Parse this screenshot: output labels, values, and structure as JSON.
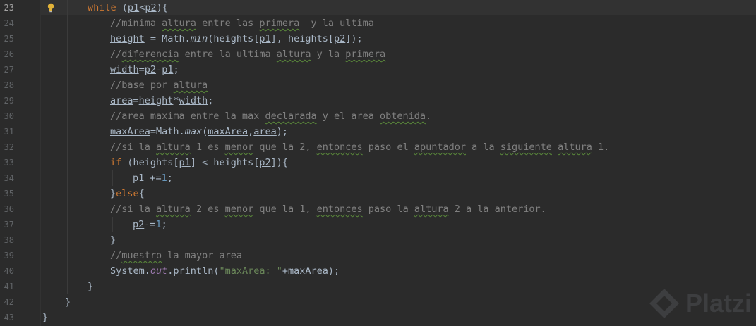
{
  "editor": {
    "line_numbers": [
      "23",
      "24",
      "25",
      "26",
      "27",
      "28",
      "29",
      "30",
      "31",
      "32",
      "33",
      "34",
      "35",
      "36",
      "37",
      "38",
      "39",
      "40",
      "41",
      "42",
      "43"
    ],
    "watermark": "Platzi",
    "lines": [
      {
        "indent": 2,
        "tokens": [
          {
            "t": "while ",
            "c": "kw"
          },
          {
            "t": "("
          },
          {
            "t": "p1",
            "c": "var"
          },
          {
            "t": "<"
          },
          {
            "t": "p2",
            "c": "var"
          },
          {
            "t": "){"
          }
        ]
      },
      {
        "indent": 3,
        "tokens": [
          {
            "t": "//minima ",
            "c": "cm"
          },
          {
            "t": "altura",
            "c": "cm typo"
          },
          {
            "t": " entre las ",
            "c": "cm"
          },
          {
            "t": "primera",
            "c": "cm typo"
          },
          {
            "t": "  y la ultima",
            "c": "cm"
          }
        ]
      },
      {
        "indent": 3,
        "tokens": [
          {
            "t": "height",
            "c": "var"
          },
          {
            "t": " = Math."
          },
          {
            "t": "min",
            "c": "mt"
          },
          {
            "t": "(heights["
          },
          {
            "t": "p1",
            "c": "var"
          },
          {
            "t": "], heights["
          },
          {
            "t": "p2",
            "c": "var"
          },
          {
            "t": "]);"
          }
        ]
      },
      {
        "indent": 3,
        "tokens": [
          {
            "t": "//",
            "c": "cm"
          },
          {
            "t": "diferencia",
            "c": "cm typo"
          },
          {
            "t": " entre la ultima ",
            "c": "cm"
          },
          {
            "t": "altura",
            "c": "cm typo"
          },
          {
            "t": " y la ",
            "c": "cm"
          },
          {
            "t": "primera",
            "c": "cm typo"
          }
        ]
      },
      {
        "indent": 3,
        "tokens": [
          {
            "t": "width",
            "c": "var"
          },
          {
            "t": "="
          },
          {
            "t": "p2",
            "c": "var"
          },
          {
            "t": "-"
          },
          {
            "t": "p1",
            "c": "var"
          },
          {
            "t": ";"
          }
        ]
      },
      {
        "indent": 3,
        "tokens": [
          {
            "t": "//base por ",
            "c": "cm"
          },
          {
            "t": "altura",
            "c": "cm typo"
          }
        ]
      },
      {
        "indent": 3,
        "tokens": [
          {
            "t": "area",
            "c": "var"
          },
          {
            "t": "="
          },
          {
            "t": "height",
            "c": "var"
          },
          {
            "t": "*"
          },
          {
            "t": "width",
            "c": "var"
          },
          {
            "t": ";"
          }
        ]
      },
      {
        "indent": 3,
        "tokens": [
          {
            "t": "//area maxima entre la max ",
            "c": "cm"
          },
          {
            "t": "declarada",
            "c": "cm typo"
          },
          {
            "t": " y el area ",
            "c": "cm"
          },
          {
            "t": "obtenida",
            "c": "cm typo"
          },
          {
            "t": ".",
            "c": "cm"
          }
        ]
      },
      {
        "indent": 3,
        "tokens": [
          {
            "t": "maxArea",
            "c": "var"
          },
          {
            "t": "=Math."
          },
          {
            "t": "max",
            "c": "mt"
          },
          {
            "t": "("
          },
          {
            "t": "maxArea",
            "c": "var"
          },
          {
            "t": ","
          },
          {
            "t": "area",
            "c": "var"
          },
          {
            "t": ");"
          }
        ]
      },
      {
        "indent": 3,
        "tokens": [
          {
            "t": "//si la ",
            "c": "cm"
          },
          {
            "t": "altura",
            "c": "cm typo"
          },
          {
            "t": " 1 es ",
            "c": "cm"
          },
          {
            "t": "menor",
            "c": "cm typo"
          },
          {
            "t": " que la 2, ",
            "c": "cm"
          },
          {
            "t": "entonces",
            "c": "cm typo"
          },
          {
            "t": " paso el ",
            "c": "cm"
          },
          {
            "t": "apuntador",
            "c": "cm typo"
          },
          {
            "t": " a la ",
            "c": "cm"
          },
          {
            "t": "siguiente",
            "c": "cm typo"
          },
          {
            "t": " ",
            "c": "cm"
          },
          {
            "t": "altura",
            "c": "cm typo"
          },
          {
            "t": " 1.",
            "c": "cm"
          }
        ]
      },
      {
        "indent": 3,
        "tokens": [
          {
            "t": "if ",
            "c": "kw"
          },
          {
            "t": "(heights["
          },
          {
            "t": "p1",
            "c": "var"
          },
          {
            "t": "] < heights["
          },
          {
            "t": "p2",
            "c": "var"
          },
          {
            "t": "]){"
          }
        ]
      },
      {
        "indent": 4,
        "tokens": [
          {
            "t": "p1",
            "c": "var"
          },
          {
            "t": " +="
          },
          {
            "t": "1",
            "c": "num"
          },
          {
            "t": ";"
          }
        ]
      },
      {
        "indent": 3,
        "tokens": [
          {
            "t": "}"
          },
          {
            "t": "else",
            "c": "kw"
          },
          {
            "t": "{"
          }
        ]
      },
      {
        "indent": 3,
        "tokens": [
          {
            "t": "//si la ",
            "c": "cm"
          },
          {
            "t": "altura",
            "c": "cm typo"
          },
          {
            "t": " 2 es ",
            "c": "cm"
          },
          {
            "t": "menor",
            "c": "cm typo"
          },
          {
            "t": " que la 1, ",
            "c": "cm"
          },
          {
            "t": "entonces",
            "c": "cm typo"
          },
          {
            "t": " paso la ",
            "c": "cm"
          },
          {
            "t": "altura",
            "c": "cm typo"
          },
          {
            "t": " 2 a la anterior.",
            "c": "cm"
          }
        ]
      },
      {
        "indent": 4,
        "tokens": [
          {
            "t": "p2",
            "c": "var"
          },
          {
            "t": "-="
          },
          {
            "t": "1",
            "c": "num"
          },
          {
            "t": ";"
          }
        ]
      },
      {
        "indent": 3,
        "tokens": [
          {
            "t": "}"
          }
        ]
      },
      {
        "indent": 3,
        "tokens": [
          {
            "t": "//",
            "c": "cm"
          },
          {
            "t": "muestro",
            "c": "cm typo"
          },
          {
            "t": " la mayor area",
            "c": "cm"
          }
        ]
      },
      {
        "indent": 3,
        "tokens": [
          {
            "t": "System."
          },
          {
            "t": "out",
            "c": "fld"
          },
          {
            "t": ".println("
          },
          {
            "t": "\"maxArea: \"",
            "c": "str"
          },
          {
            "t": "+"
          },
          {
            "t": "maxArea",
            "c": "var"
          },
          {
            "t": ");"
          }
        ]
      },
      {
        "indent": 2,
        "tokens": [
          {
            "t": "}"
          }
        ]
      },
      {
        "indent": 1,
        "tokens": [
          {
            "t": "}"
          }
        ]
      },
      {
        "indent": 0,
        "tokens": [
          {
            "t": "}"
          }
        ]
      }
    ]
  },
  "colors": {
    "background": "#2b2b2b",
    "current_line": "#323232",
    "keyword": "#cc7832",
    "comment": "#808080",
    "number": "#6897bb",
    "string": "#6a8759",
    "field": "#9876aa",
    "default": "#a9b7c6",
    "bulb": "#e2b339"
  }
}
